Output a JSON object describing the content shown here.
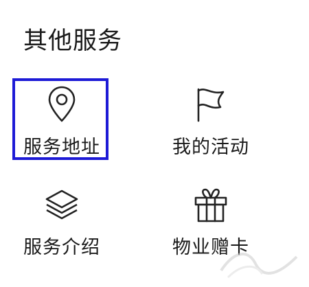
{
  "section": {
    "title": "其他服务"
  },
  "services": [
    {
      "label": "服务地址",
      "icon": "location-pin-icon"
    },
    {
      "label": "我的活动",
      "icon": "flag-icon"
    },
    {
      "label": "服务介绍",
      "icon": "layers-icon"
    },
    {
      "label": "物业赠卡",
      "icon": "gift-icon"
    }
  ],
  "colors": {
    "highlight": "#1d1ad6",
    "text": "#1a1a1a",
    "background": "#ffffff"
  }
}
